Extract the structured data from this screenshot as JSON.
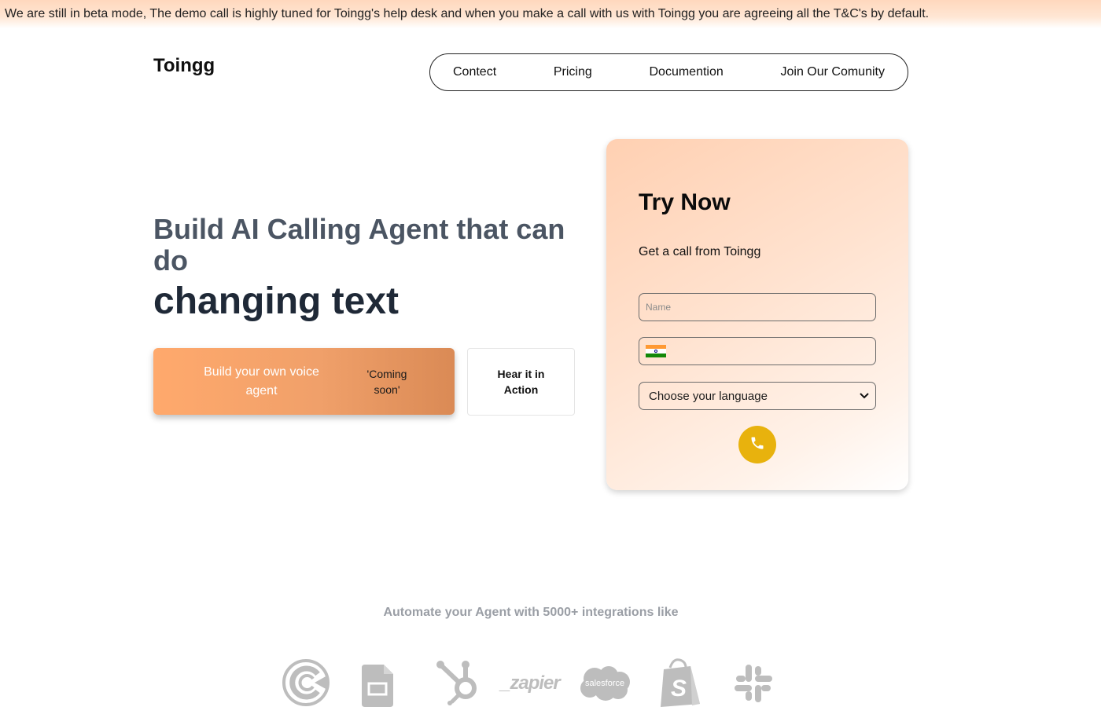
{
  "banner": {
    "text": "We are still in beta mode, The demo call is highly tuned for Toingg's help desk and when you make a call with us with Toingg you are agreeing all the T&C's by default."
  },
  "header": {
    "logo": "Toingg",
    "nav": [
      {
        "label": "Contect"
      },
      {
        "label": "Pricing"
      },
      {
        "label": "Documention"
      },
      {
        "label": "Join Our Comunity"
      }
    ]
  },
  "hero": {
    "title": "Build AI Calling Agent that can do",
    "changing_text": "changing text",
    "build_button": {
      "label": "Build your own voice agent",
      "badge": "'Coming soon'"
    },
    "hear_button": {
      "label": "Hear it in Action"
    }
  },
  "try_now": {
    "title": "Try Now",
    "subtitle": "Get a call from Toingg",
    "name_placeholder": "Name",
    "phone_value": "",
    "country_flag": "india-flag-icon",
    "language_select": {
      "selected": "Choose your language"
    },
    "call_button": {
      "icon": "phone-icon",
      "color": "#e8b20d"
    }
  },
  "integrations": {
    "title": "Automate your Agent with 5000+ integrations like",
    "logos": [
      {
        "name": "circular-c-logo-icon"
      },
      {
        "name": "google-sheets-icon"
      },
      {
        "name": "hubspot-icon"
      },
      {
        "name": "zapier-icon",
        "text": "_zapier"
      },
      {
        "name": "salesforce-icon",
        "text": "salesforce"
      },
      {
        "name": "shopify-icon"
      },
      {
        "name": "slack-icon"
      }
    ]
  },
  "colors": {
    "accent_orange": "#ffa96c",
    "call_yellow": "#e8b20d",
    "logo_gray": "#bdbdbd"
  }
}
